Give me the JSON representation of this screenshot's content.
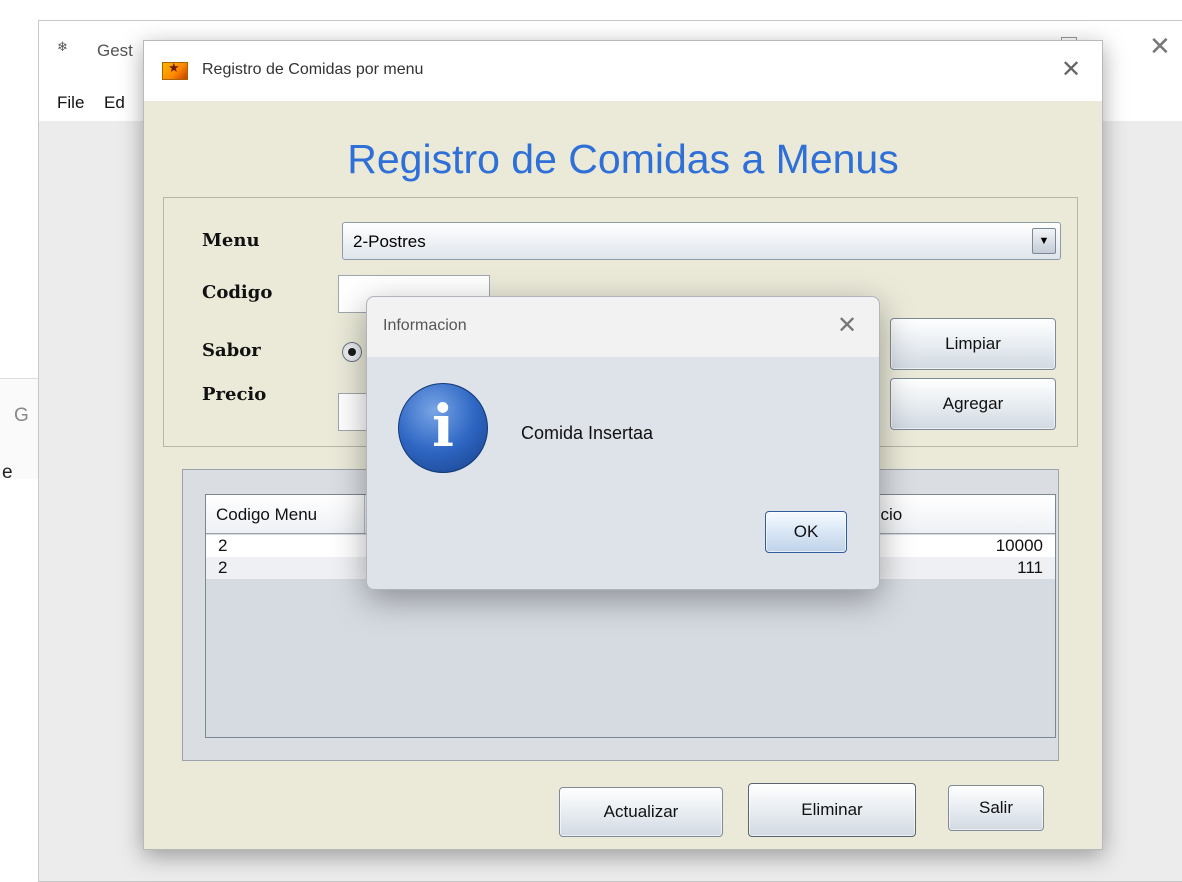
{
  "background_window": {
    "title": "Gest",
    "app_icon": "❄",
    "menu": [
      "File",
      "Ed"
    ],
    "left_fragments": [
      "G",
      "e"
    ]
  },
  "dialog": {
    "title": "Registro de Comidas por menu",
    "heading": "Registro de Comidas a Menus",
    "form": {
      "menu_label": "Menu",
      "menu_value": "2-Postres",
      "codigo_label": "Codigo",
      "codigo_value": "",
      "sabor_label": "Sabor",
      "precio_label": "Precio",
      "precio_value": ""
    },
    "buttons": {
      "limpiar": "Limpiar",
      "agregar": "Agregar",
      "actualizar": "Actualizar",
      "eliminar": "Eliminar",
      "salir": "Salir"
    },
    "table": {
      "headers": [
        "Codigo Menu",
        "ecio"
      ],
      "rows": [
        {
          "codigo_menu": "2",
          "precio": "10000"
        },
        {
          "codigo_menu": "2",
          "precio": "111"
        }
      ]
    }
  },
  "info_dialog": {
    "title": "Informacion",
    "message": "Comida Insertaa",
    "ok_label": "OK",
    "icon_glyph": "i"
  },
  "colors": {
    "heading": "#2f6fd8",
    "dialog_bg": "#ebead9",
    "info_bg": "#dee2e9"
  }
}
